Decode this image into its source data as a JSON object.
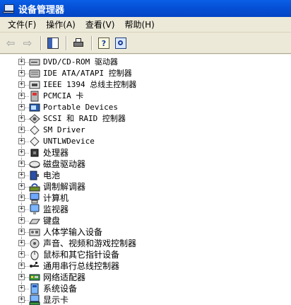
{
  "window": {
    "title": "设备管理器"
  },
  "menu": [
    {
      "label": "文件(F)"
    },
    {
      "label": "操作(A)"
    },
    {
      "label": "查看(V)"
    },
    {
      "label": "帮助(H)"
    }
  ],
  "toolbar": {
    "buttons": [
      {
        "icon": "back-arrow-icon",
        "glyph": "⇦"
      },
      {
        "icon": "forward-arrow-icon",
        "glyph": "⇨"
      }
    ]
  },
  "tree": {
    "expander_glyph": "+",
    "items": [
      {
        "label": "DVD/CD-ROM 驱动器",
        "icon": "cdrom-drive-icon"
      },
      {
        "label": "IDE ATA/ATAPI 控制器",
        "icon": "ide-controller-icon"
      },
      {
        "label": "IEEE 1394 总线主控制器",
        "icon": "ieee1394-controller-icon"
      },
      {
        "label": "PCMCIA 卡",
        "icon": "pcmcia-card-icon"
      },
      {
        "label": "Portable Devices",
        "icon": "portable-device-icon"
      },
      {
        "label": "SCSI 和 RAID 控制器",
        "icon": "scsi-controller-icon"
      },
      {
        "label": "SM Driver",
        "icon": "unknown-device-icon"
      },
      {
        "label": "UNTLWDevice",
        "icon": "unknown-device-icon"
      },
      {
        "label": "处理器",
        "icon": "processor-icon"
      },
      {
        "label": "磁盘驱动器",
        "icon": "disk-drive-icon"
      },
      {
        "label": "电池",
        "icon": "battery-icon"
      },
      {
        "label": "调制解调器",
        "icon": "modem-icon"
      },
      {
        "label": "计算机",
        "icon": "computer-icon"
      },
      {
        "label": "监视器",
        "icon": "monitor-icon"
      },
      {
        "label": "键盘",
        "icon": "keyboard-icon"
      },
      {
        "label": "人体学输入设备",
        "icon": "hid-icon"
      },
      {
        "label": "声音、视频和游戏控制器",
        "icon": "sound-controller-icon"
      },
      {
        "label": "鼠标和其它指针设备",
        "icon": "mouse-icon"
      },
      {
        "label": "通用串行总线控制器",
        "icon": "usb-icon"
      },
      {
        "label": "网络适配器",
        "icon": "network-adapter-icon"
      },
      {
        "label": "系统设备",
        "icon": "system-device-icon"
      },
      {
        "label": "显示卡",
        "icon": "display-adapter-icon"
      }
    ]
  }
}
